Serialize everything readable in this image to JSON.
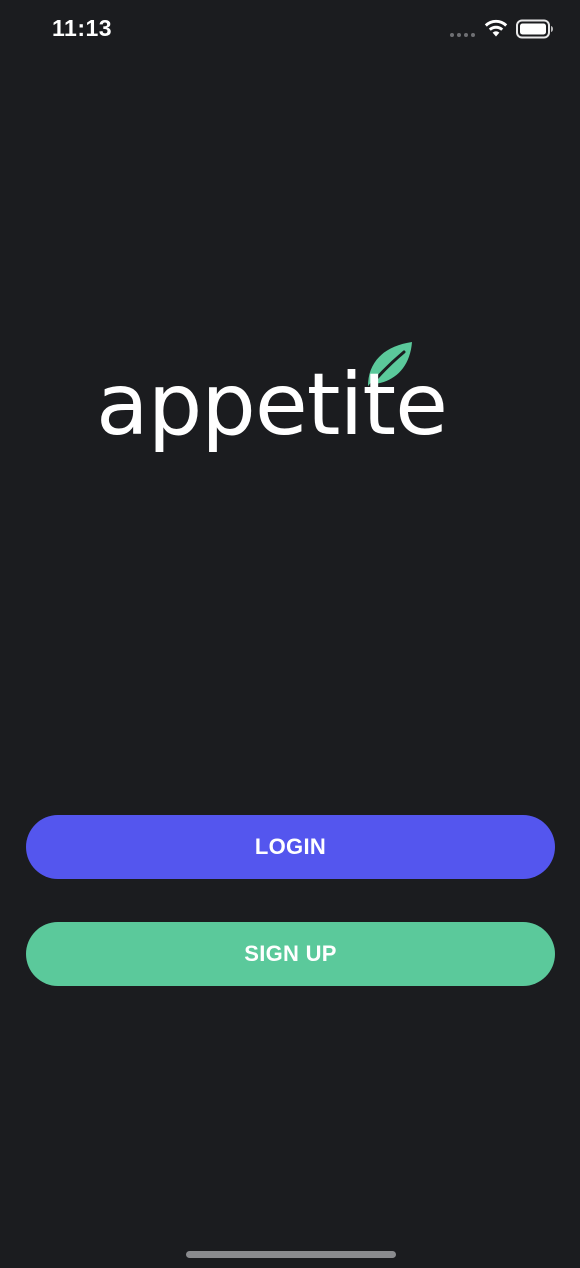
{
  "status_bar": {
    "time": "11:13",
    "icons": [
      "signal-dots-icon",
      "wifi-icon",
      "battery-icon"
    ]
  },
  "logo": {
    "text": "appetite",
    "icon": "leaf-icon",
    "leaf_color": "#5bc99b"
  },
  "buttons": {
    "login_label": "LOGIN",
    "signup_label": "SIGN UP"
  },
  "colors": {
    "background": "#1b1c1f",
    "login": "#5456ee",
    "signup": "#5bc99b"
  }
}
